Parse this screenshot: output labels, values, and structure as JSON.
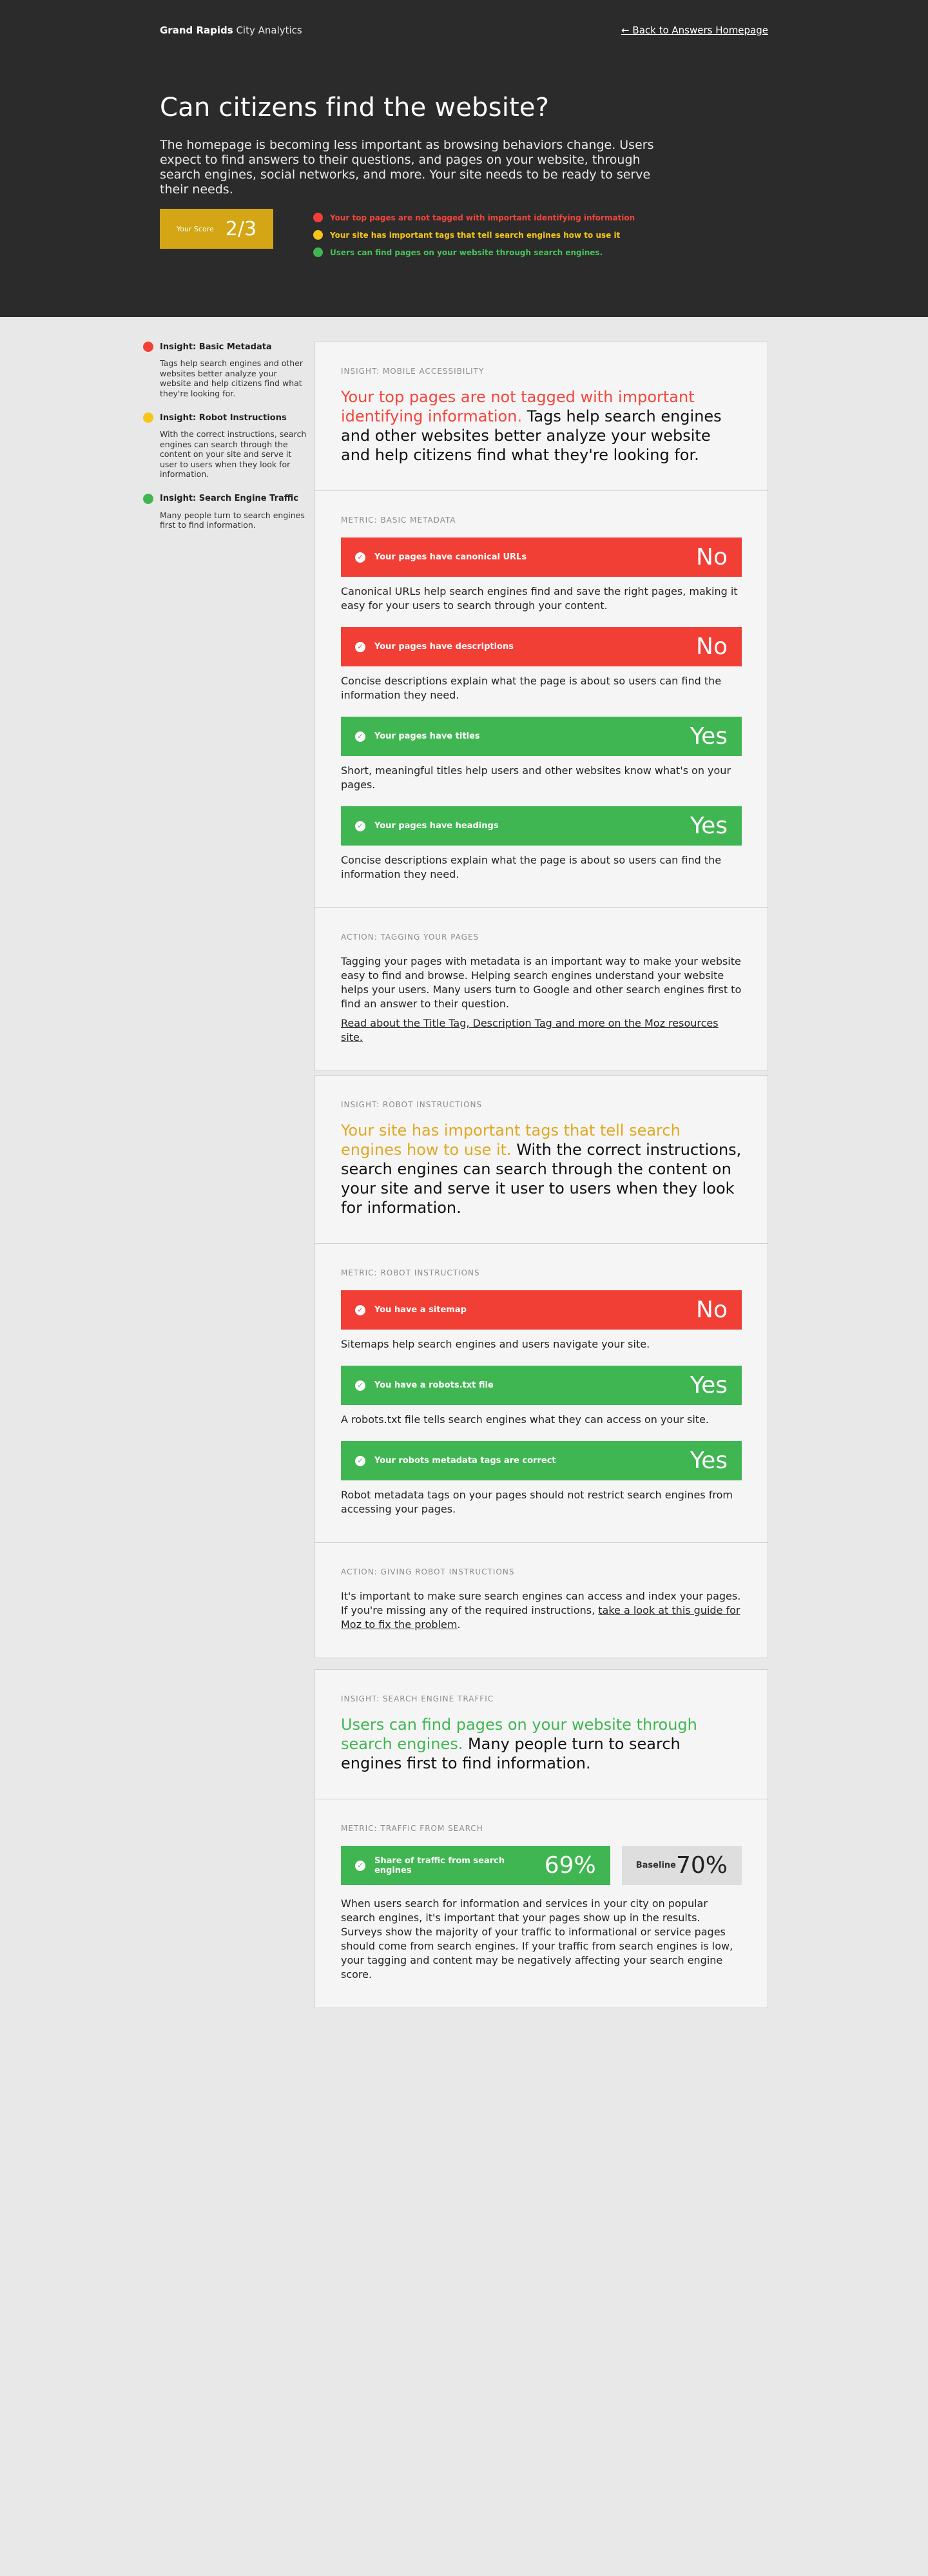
{
  "header": {
    "brand_bold": "Grand Rapids",
    "brand_rest": " City Analytics",
    "back_link": "← Back to Answers Homepage",
    "title": "Can citizens find the website?",
    "subtitle": "The homepage is becoming less important as browsing behaviors change. Users expect to find answers to their questions, and pages on your website, through search engines, social networks, and more. Your site needs to be ready to serve their needs.",
    "score_label": "Your Score",
    "score_value": "2/3",
    "legend": [
      {
        "text": "Your top pages are not tagged with important identifying information",
        "color": "#f13f36"
      },
      {
        "text": "Your site has important tags that tell search engines how to use it",
        "color": "#f5c518"
      },
      {
        "text": "Users can find pages on your website through search engines.",
        "color": "#40b652"
      }
    ]
  },
  "sidebar": {
    "items": [
      {
        "title": "Insight: Basic Metadata",
        "text": "Tags help search engines and other websites better analyze your website and help citizens find what they're looking for.",
        "color": "#f13f36"
      },
      {
        "title": "Insight: Robot Instructions",
        "text": "With the correct instructions, search engines can search through the content on your site and serve it user to users when they look for information.",
        "color": "#f5c518"
      },
      {
        "title": "Insight: Search Engine Traffic",
        "text": "Many people turn to search engines first to find information.",
        "color": "#40b652"
      }
    ]
  },
  "card1": {
    "insight_eyebrow": "Insight: Mobile Accessibility",
    "insight_highlight": "Your top pages are not tagged with important identifying information.",
    "insight_rest": " Tags help search engines and other websites better analyze your website and help citizens find what they're looking for.",
    "metric_eyebrow": "Metric: Basic Metadata",
    "metrics": [
      {
        "label": "Your pages have canonical URLs",
        "value": "No",
        "desc": "Canonical URLs help search engines find and save the right pages, making it easy for your users to search through your content."
      },
      {
        "label": "Your pages have descriptions",
        "value": "No",
        "desc": "Concise descriptions explain what the page is about so users can find the information they need."
      },
      {
        "label": "Your pages have titles",
        "value": "Yes",
        "desc": "Short, meaningful titles help users and other websites know what's on your pages."
      },
      {
        "label": "Your pages have headings",
        "value": "Yes",
        "desc": "Concise descriptions explain what the page is about so users can find the information they need."
      }
    ],
    "action_eyebrow": "Action: Tagging Your Pages",
    "action_text": "Tagging your pages with metadata is an important way to make your website easy to find and browse. Helping search engines understand your website helps your users. Many users turn to Google and other search engines first to find an answer to their question.",
    "action_link": "Read about the Title Tag, Description Tag and more on the Moz resources site."
  },
  "card2": {
    "insight_eyebrow": "Insight: Robot Instructions",
    "insight_highlight": "Your site has important tags that tell search engines how to use it.",
    "insight_rest": " With the correct instructions, search engines can search through the content on your site and serve it user to users when they look for information.",
    "metric_eyebrow": "Metric: Robot Instructions",
    "metrics": [
      {
        "label": "You have a sitemap",
        "value": "No",
        "desc": "Sitemaps help search engines and users navigate your site."
      },
      {
        "label": "You have a robots.txt file",
        "value": "Yes",
        "desc": "A robots.txt file tells search engines what they can access on your site."
      },
      {
        "label": "Your robots metadata tags are correct",
        "value": "Yes",
        "desc": "Robot metadata tags on your pages should not restrict search engines from accessing your pages."
      }
    ],
    "action_eyebrow": "Action: Giving Robot Instructions",
    "action_text": "It's important to make sure search engines can access and index your pages. If you're missing any of the required instructions, ",
    "action_link": "take a look at this guide for Moz to fix the problem",
    "action_end": "."
  },
  "card3": {
    "insight_eyebrow": "Insight: Search Engine Traffic",
    "insight_highlight": "Users can find pages on your website through search engines.",
    "insight_rest": " Many people turn to search engines first to find information.",
    "metric_eyebrow": "Metric: Traffic from Search",
    "traffic_label": "Share of traffic from search engines",
    "traffic_value": "69%",
    "baseline_label": "Baseline",
    "baseline_value": "70%",
    "desc": "When users search for information and services in your city on popular search engines, it's important that your pages show up in the results. Surveys show the majority of your traffic to informational or service pages should come from search engines. If your traffic from search engines is low, your tagging and content may be negatively affecting your search engine score."
  }
}
